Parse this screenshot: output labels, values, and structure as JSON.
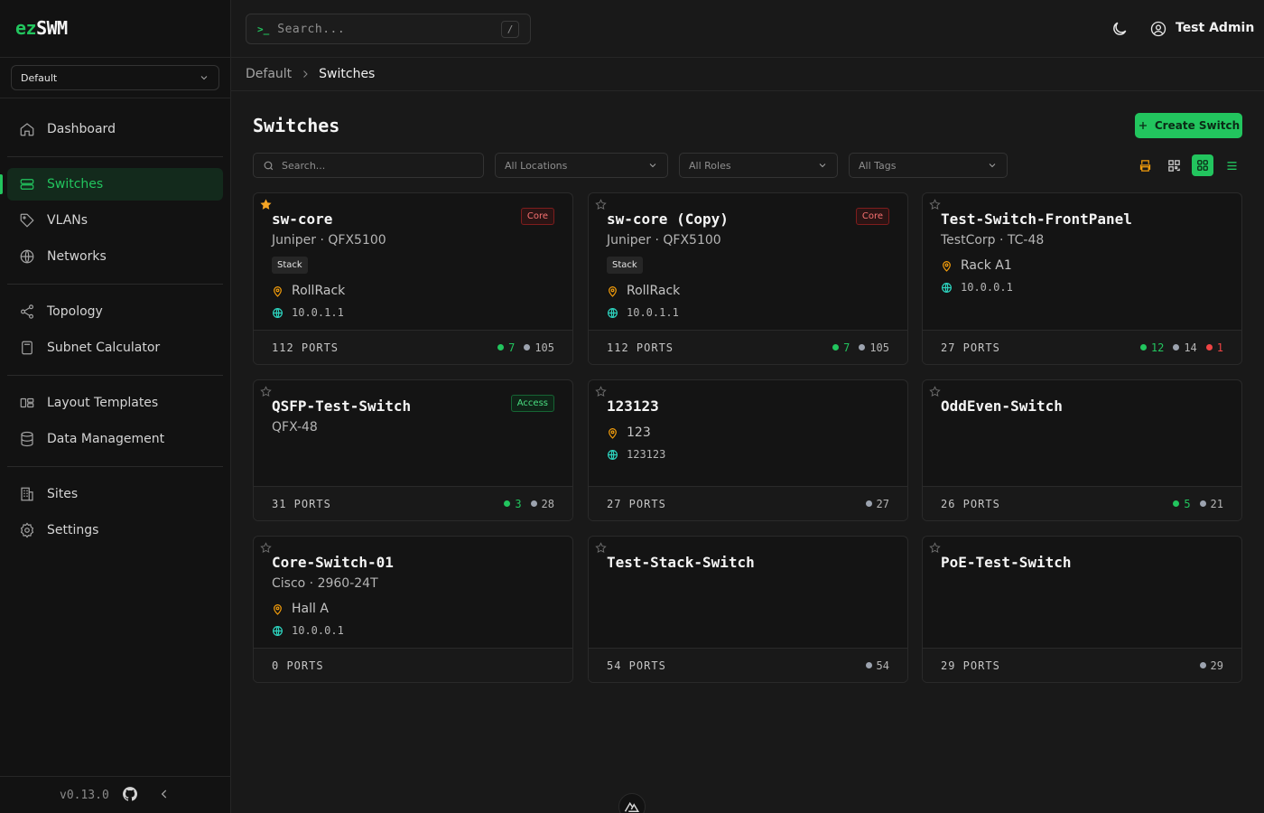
{
  "app": {
    "logo_a": "ez",
    "logo_b": "SWM",
    "version": "v0.13.0"
  },
  "site_selector": {
    "value": "Default"
  },
  "nav": {
    "dashboard": "Dashboard",
    "switches": "Switches",
    "vlans": "VLANs",
    "networks": "Networks",
    "topology": "Topology",
    "subnet_calculator": "Subnet Calculator",
    "layout_templates": "Layout Templates",
    "data_management": "Data Management",
    "sites": "Sites",
    "settings": "Settings"
  },
  "header": {
    "search_prompt": ">_",
    "search_placeholder": "Search...",
    "search_shortcut": "/",
    "user_name": "Test Admin"
  },
  "breadcrumb": {
    "root": "Default",
    "current": "Switches"
  },
  "page": {
    "title": "Switches",
    "create_label": "Create Switch",
    "filters": {
      "search_placeholder": "Search...",
      "locations": "All Locations",
      "roles": "All Roles",
      "tags": "All Tags"
    }
  },
  "colors": {
    "accent": "#22c55e",
    "favorite": "#f5a524",
    "location_icon": "#f59e0b",
    "ip_icon": "#2dd4bf",
    "error": "#ef4444"
  },
  "cards": [
    {
      "name": "sw-core",
      "favorite": true,
      "sub": "Juniper · QFX5100",
      "badge": "Core",
      "tag": "Stack",
      "location": "RollRack",
      "ip": "10.0.1.1",
      "ports": "112 PORTS",
      "up": "7",
      "down": "105"
    },
    {
      "name": "sw-core (Copy)",
      "favorite": false,
      "sub": "Juniper · QFX5100",
      "badge": "Core",
      "tag": "Stack",
      "location": "RollRack",
      "ip": "10.0.1.1",
      "ports": "112 PORTS",
      "up": "7",
      "down": "105"
    },
    {
      "name": "Test-Switch-FrontPanel",
      "favorite": false,
      "sub": "TestCorp · TC-48",
      "location": "Rack A1",
      "ip": "10.0.0.1",
      "ports": "27 PORTS",
      "up": "12",
      "down": "14",
      "err": "1"
    },
    {
      "name": "QSFP-Test-Switch",
      "favorite": false,
      "sub": "QFX-48",
      "badge": "Access",
      "ports": "31 PORTS",
      "up": "3",
      "down": "28"
    },
    {
      "name": "123123",
      "favorite": false,
      "location": "123",
      "ip": "123123",
      "ports": "27 PORTS",
      "down": "27"
    },
    {
      "name": "OddEven-Switch",
      "favorite": false,
      "ports": "26 PORTS",
      "up": "5",
      "down": "21"
    },
    {
      "name": "Core-Switch-01",
      "favorite": false,
      "sub": "Cisco · 2960-24T",
      "location": "Hall A",
      "ip": "10.0.0.1",
      "ports": "0 PORTS"
    },
    {
      "name": "Test-Stack-Switch",
      "favorite": false,
      "ports": "54 PORTS",
      "down": "54"
    },
    {
      "name": "PoE-Test-Switch",
      "favorite": false,
      "ports": "29 PORTS",
      "down": "29"
    }
  ]
}
